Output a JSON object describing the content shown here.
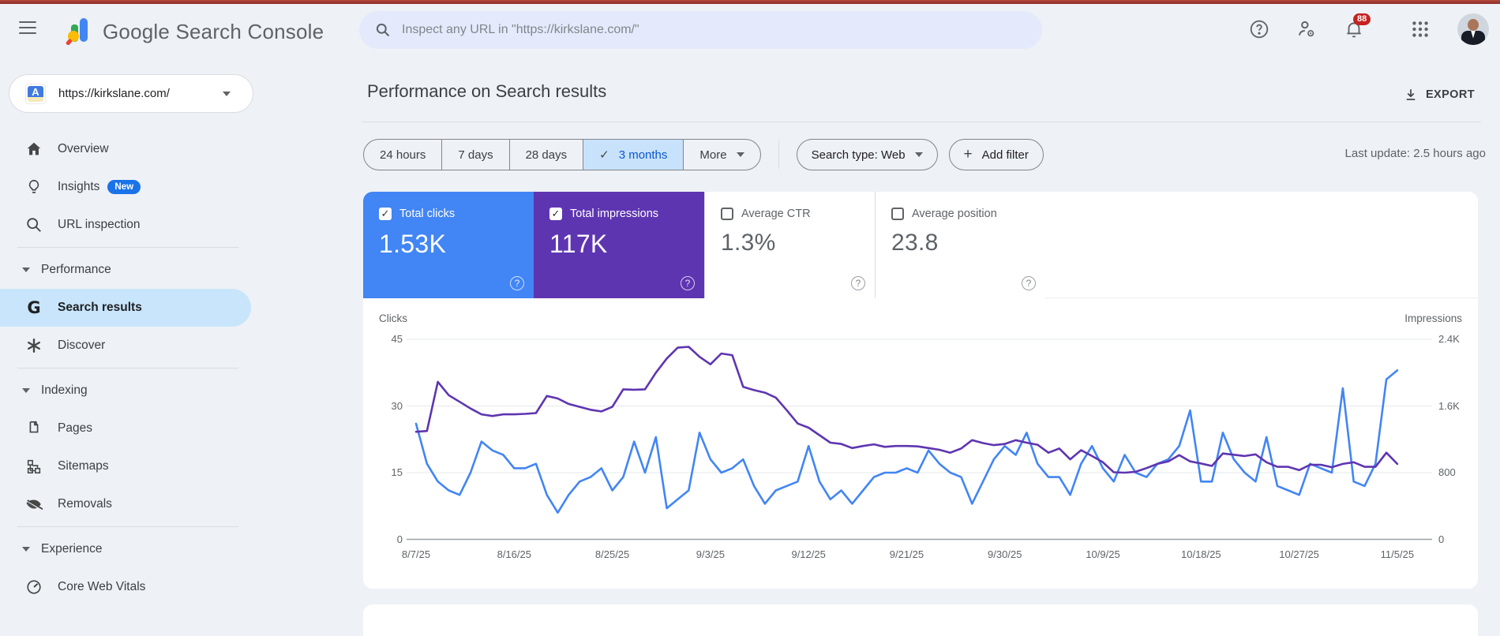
{
  "topbar": {
    "brand": "Google Search Console",
    "search_placeholder": "Inspect any URL in \"https://kirkslane.com/\"",
    "notification_count": "88"
  },
  "sidebar": {
    "property": "https://kirkslane.com/",
    "favicon_letter": "A",
    "items": [
      {
        "label": "Overview"
      },
      {
        "label": "Insights",
        "badge": "New"
      },
      {
        "label": "URL inspection"
      }
    ],
    "sections": [
      {
        "label": "Performance",
        "children": [
          {
            "label": "Search results",
            "selected": true
          },
          {
            "label": "Discover"
          }
        ]
      },
      {
        "label": "Indexing",
        "children": [
          {
            "label": "Pages"
          },
          {
            "label": "Sitemaps"
          },
          {
            "label": "Removals"
          }
        ]
      },
      {
        "label": "Experience",
        "children": [
          {
            "label": "Core Web Vitals"
          }
        ]
      }
    ]
  },
  "page": {
    "title": "Performance on Search results",
    "export_label": "EXPORT",
    "last_update": "Last update: 2.5 hours ago",
    "date_ranges": {
      "r0": "24 hours",
      "r1": "7 days",
      "r2": "28 days",
      "r3": "3 months",
      "selected": "3 months",
      "more": "More"
    },
    "search_type_chip": "Search type: Web",
    "add_filter_chip": "Add filter"
  },
  "metrics": {
    "cards": [
      {
        "label": "Total clicks",
        "value": "1.53K",
        "checked": true,
        "color": "#4285f4"
      },
      {
        "label": "Total impressions",
        "value": "117K",
        "checked": true,
        "color": "#5e35b1"
      },
      {
        "label": "Average CTR",
        "value": "1.3%",
        "checked": false
      },
      {
        "label": "Average position",
        "value": "23.8",
        "checked": false
      }
    ],
    "help_glyph": "?"
  },
  "chart_data": {
    "type": "line",
    "title": "Performance on Search results",
    "x_start": "8/7/25",
    "x_end": "11/5/25",
    "xtick_interval_days": 9,
    "xtick_labels": [
      "8/7/25",
      "8/16/25",
      "8/25/25",
      "9/3/25",
      "9/12/25",
      "9/21/25",
      "9/30/25",
      "10/9/25",
      "10/18/25",
      "10/27/25",
      "11/5/25"
    ],
    "left_axis": {
      "title": "Clicks",
      "max": 45,
      "ticks": [
        "45",
        "30",
        "15",
        "0"
      ]
    },
    "right_axis": {
      "title": "Impressions",
      "max": 2400,
      "ticks": [
        "2.4K",
        "1.6K",
        "800",
        "0"
      ]
    },
    "grid": true,
    "legend_position": "none",
    "series": [
      {
        "name": "Total clicks",
        "axis": "left",
        "color": "#4285f4",
        "values": [
          26,
          17,
          13,
          11,
          10,
          15,
          22,
          20,
          19,
          16,
          16,
          17,
          10,
          6,
          10,
          13,
          14,
          16,
          11,
          14,
          22,
          15,
          23,
          7,
          9,
          11,
          24,
          18,
          15,
          16,
          18,
          12,
          8,
          11,
          12,
          13,
          21,
          13,
          9,
          11,
          8,
          11,
          14,
          15,
          15,
          16,
          15,
          20,
          17,
          15,
          14,
          8,
          13,
          18,
          21,
          19,
          24,
          17,
          14,
          14,
          10,
          17,
          21,
          16,
          13,
          19,
          15,
          14,
          17,
          18,
          21,
          29,
          13,
          13,
          24,
          18,
          15,
          13,
          23,
          12,
          11,
          10,
          17,
          16,
          15,
          34,
          13,
          12,
          17,
          36,
          38
        ]
      },
      {
        "name": "Total impressions",
        "axis": "right",
        "color": "#5e35b1",
        "values": [
          1290,
          1300,
          1890,
          1730,
          1650,
          1570,
          1500,
          1480,
          1500,
          1500,
          1505,
          1515,
          1720,
          1690,
          1625,
          1590,
          1555,
          1535,
          1590,
          1800,
          1795,
          1800,
          2000,
          2170,
          2300,
          2310,
          2190,
          2100,
          2230,
          2210,
          1830,
          1790,
          1760,
          1700,
          1550,
          1390,
          1340,
          1250,
          1160,
          1145,
          1095,
          1120,
          1140,
          1110,
          1120,
          1120,
          1115,
          1095,
          1075,
          1040,
          1090,
          1190,
          1155,
          1130,
          1145,
          1190,
          1160,
          1135,
          1040,
          1090,
          960,
          1070,
          1000,
          925,
          805,
          800,
          810,
          855,
          905,
          935,
          1010,
          935,
          910,
          880,
          1030,
          1015,
          1000,
          1020,
          925,
          870,
          870,
          830,
          895,
          895,
          865,
          905,
          925,
          870,
          870,
          1040,
          905
        ]
      }
    ]
  }
}
